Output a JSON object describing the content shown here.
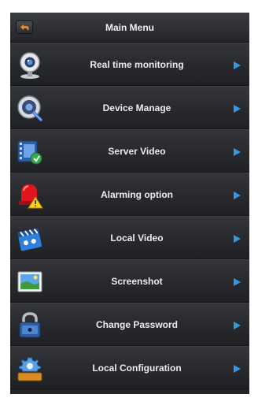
{
  "header": {
    "title": "Main Menu",
    "back_icon": "back-arrow-icon"
  },
  "menu": {
    "items": [
      {
        "label": "Real time monitoring",
        "icon": "webcam-icon"
      },
      {
        "label": "Device Manage",
        "icon": "device-settings-icon"
      },
      {
        "label": "Server Video",
        "icon": "video-film-icon"
      },
      {
        "label": "Alarming option",
        "icon": "alarm-siren-icon"
      },
      {
        "label": "Local Video",
        "icon": "clapperboard-icon"
      },
      {
        "label": "Screenshot",
        "icon": "picture-icon"
      },
      {
        "label": "Change Password",
        "icon": "lock-icon"
      },
      {
        "label": "Local Configuration",
        "icon": "gear-config-icon"
      }
    ],
    "arrow_icon": "chevron-right-icon"
  },
  "colors": {
    "accent_arrow": "#2f9be8",
    "background": "#222427",
    "text": "#ececec"
  }
}
